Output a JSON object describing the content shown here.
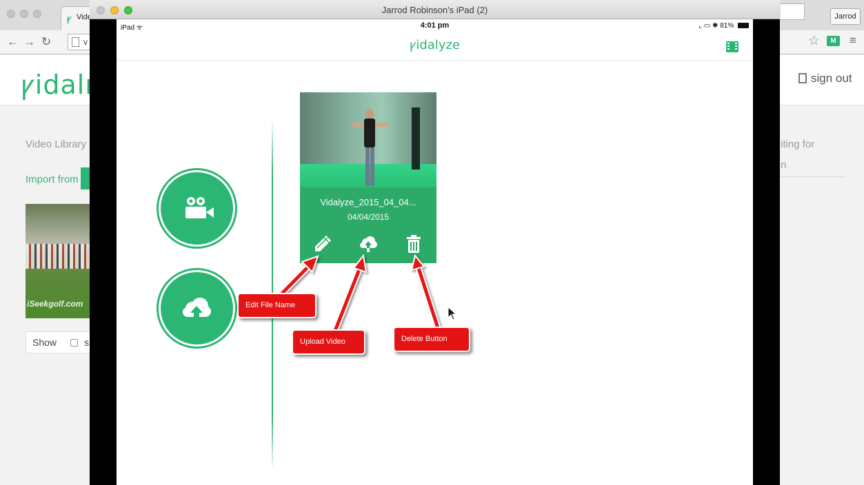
{
  "browser": {
    "tab_title": "Vide",
    "url_fragment": "v",
    "user_button": "Jarrod",
    "extension_label": "M"
  },
  "site": {
    "logo": "ꝩidalı",
    "signout": "sign out",
    "library_title": "Video Library",
    "import_label": "Import from",
    "thumbnail_watermark": "iSeekgolf.com",
    "show_label": "Show",
    "show_checkbox_label": "s",
    "right_panel_line1": "iting for",
    "right_panel_line2": "n"
  },
  "simulator": {
    "window_title": "Jarrod Robinson's iPad (2)",
    "status": {
      "carrier": "iPad ᯤ",
      "time": "4:01 pm",
      "battery": "81%",
      "right_icons": "⌞ ▭ ✱"
    },
    "app_logo": "ꝩidalyze"
  },
  "video_card": {
    "name": "Vidalyze_2015_04_04...",
    "date": "04/04/2015"
  },
  "annotations": {
    "edit": "Edit File Name",
    "upload": "Upload Video",
    "delete": "Delete Button"
  },
  "colors": {
    "brand_green": "#2bb673",
    "card_green": "#2eaa68",
    "callout_red": "#e41414"
  },
  "icons": {
    "record": "video-camera-icon",
    "upload_circle": "cloud-upload-icon",
    "edit": "pencil-icon",
    "upload": "cloud-upload-icon",
    "delete": "trash-icon",
    "film": "film-strip-icon"
  }
}
